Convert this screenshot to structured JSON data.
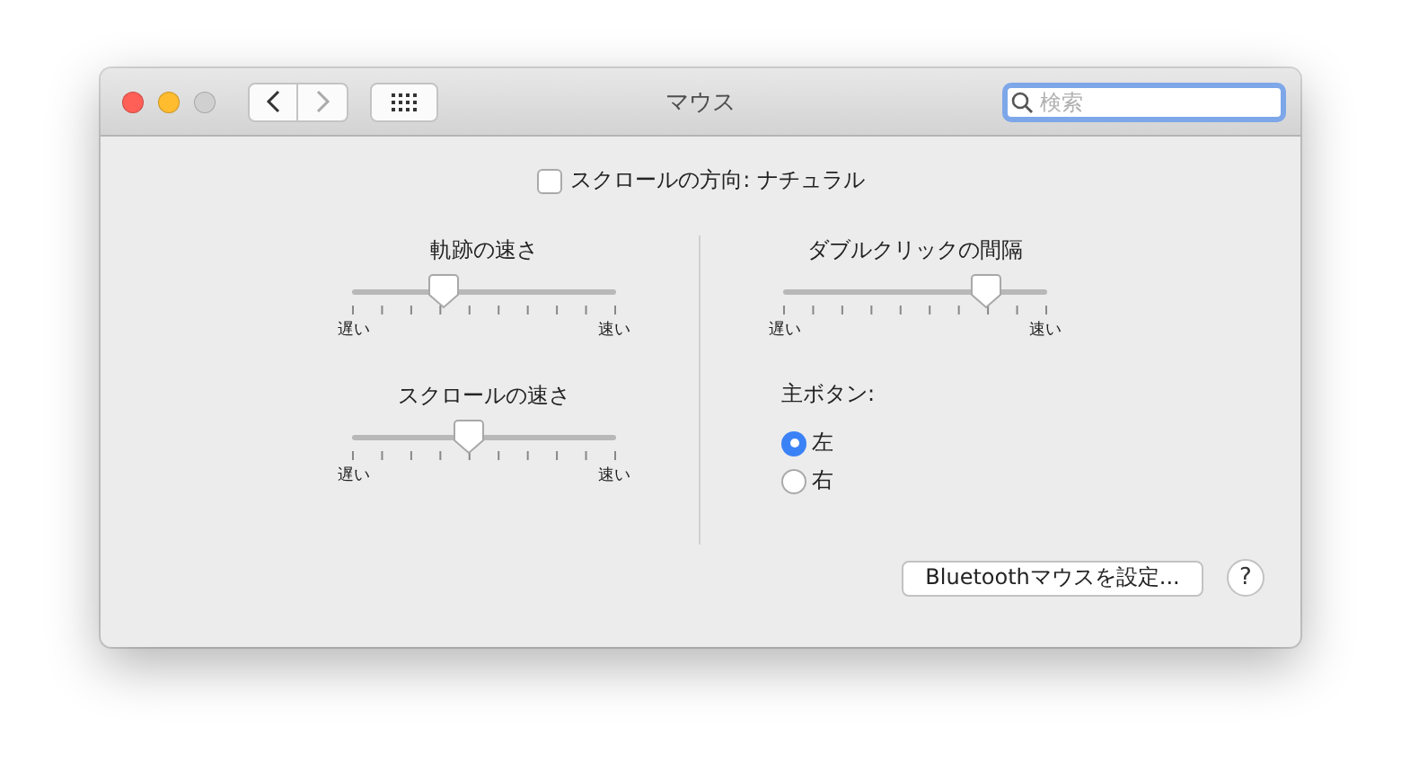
{
  "window": {
    "title": "マウス",
    "search": {
      "placeholder": "検索"
    }
  },
  "scroll_direction": {
    "label": "スクロールの方向: ナチュラル",
    "checked": false
  },
  "sliders_left": [
    {
      "title": "軌跡の速さ",
      "level": 0.35,
      "min_label": "遅い",
      "max_label": "速い"
    },
    {
      "title": "スクロールの速さ",
      "level": 0.44,
      "min_label": "遅い",
      "max_label": "速い"
    }
  ],
  "slider_right": {
    "title": "ダブルクリックの間隔",
    "level": 0.77,
    "min_label": "遅い",
    "max_label": "速い"
  },
  "primary_button": {
    "label": "主ボタン:",
    "options": [
      {
        "label": "左",
        "selected": true
      },
      {
        "label": "右",
        "selected": false
      }
    ]
  },
  "bluetooth_button": "Bluetoothマウスを設定...",
  "help_button": "?"
}
